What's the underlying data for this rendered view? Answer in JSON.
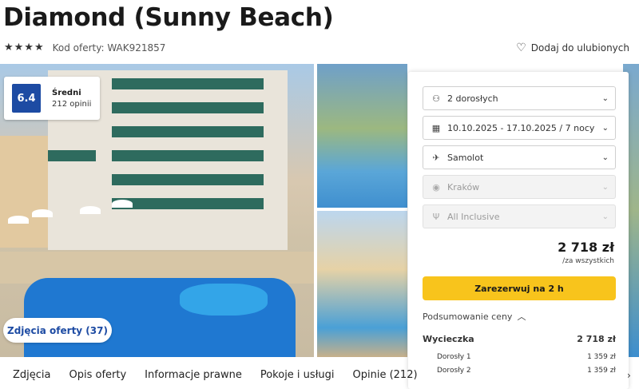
{
  "hotel": {
    "title": "Diamond (Sunny Beach)",
    "stars": "★★★★",
    "offer_code": "Kod oferty: WAK921857",
    "favorite_label": "Dodaj do ulubionych"
  },
  "rating": {
    "score": "6.4",
    "label": "Średni",
    "count": "212 opinii"
  },
  "photos_button": "Zdjęcia oferty (37)",
  "booking": {
    "guests": "2 dorosłych",
    "dates": "10.10.2025 - 17.10.2025 / 7 nocy",
    "transport": "Samolot",
    "departure": "Kraków",
    "board": "All Inclusive",
    "price": "2 718 zł",
    "price_note": "/za wszystkich",
    "book_label": "Zarezerwuj na 2 h",
    "summary_label": "Podsumowanie ceny",
    "summary": {
      "trip_label": "Wycieczka",
      "trip_value": "2 718 zł",
      "adult1_label": "Dorosły 1",
      "adult1_value": "1 359 zł",
      "adult2_label": "Dorosły 2",
      "adult2_value": "1 359 zł"
    }
  },
  "tabs": [
    "Zdjęcia",
    "Opis oferty",
    "Informacje prawne",
    "Pokoje i usługi",
    "Opinie (212)"
  ],
  "icons": {
    "guests": "person-icon",
    "dates": "calendar-icon",
    "transport": "plane-icon",
    "departure": "location-pin-icon",
    "board": "utensils-icon"
  },
  "colors": {
    "rating_badge": "#1d4ba3",
    "book_button": "#f8c41c",
    "link_blue": "#1d4ba3"
  }
}
